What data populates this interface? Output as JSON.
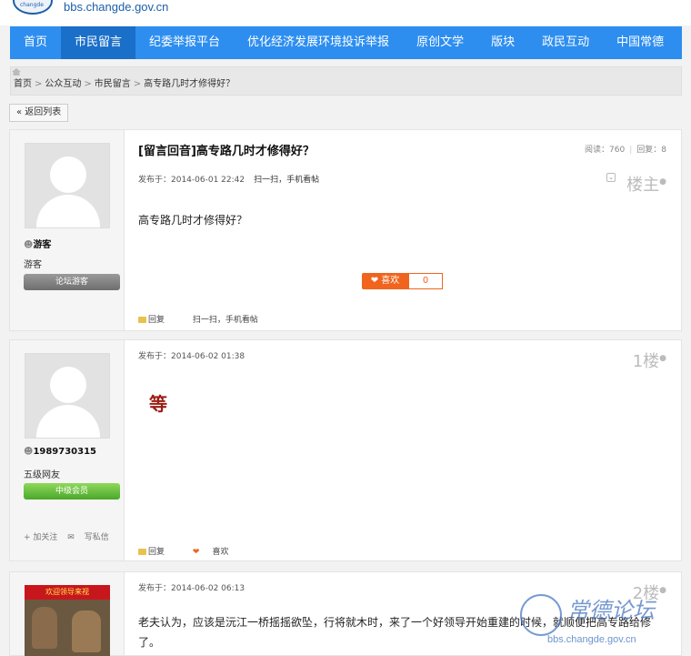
{
  "site": {
    "domain": "bbs.changde.gov.cn"
  },
  "nav": {
    "items": [
      "首页",
      "市民留言",
      "纪委举报平台",
      "优化经济发展环境投诉举报",
      "原创文学",
      "版块",
      "政民互动",
      "中国常德"
    ]
  },
  "breadcrumb": {
    "home": "首页",
    "level1": "公众互动",
    "level2": "市民留言",
    "current": "高专路几时才修得好？",
    "sep": ">"
  },
  "back_label": "« 返回列表",
  "thread": {
    "title": "[留言回音]高专路几时才修得好？",
    "views_label": "阅读：760",
    "replies_label": "回复：8"
  },
  "posts": [
    {
      "user": "游客",
      "level": "游客",
      "badge": "论坛游客",
      "time": "发布于：2014-06-01 22:42",
      "scan": "扫一扫，手机看帖",
      "floor": "楼主",
      "content": "高专路几时才修得好？",
      "like_label": "喜欢",
      "like_count": "0",
      "reply_label": "回复",
      "scan_bottom": "扫一扫，手机看帖"
    },
    {
      "user": "1989730315",
      "level": "五级网友",
      "badge": "中级会员",
      "follow_label": "+ 加关注",
      "message_label": "写私信",
      "time": "发布于：2014-06-02 01:38",
      "floor": "1楼",
      "stamp_text": "等",
      "reply_label": "回复",
      "like_label": "喜欢"
    },
    {
      "thumb_banner": "欢迎领导来视",
      "time": "发布于：2014-06-02 06:13",
      "floor": "2楼",
      "content": "老夫认为，应该是沅江一桥摇摇欲坠，行将就木时，来了一个好领导开始重建的时候，就顺便把高专路给修了。"
    }
  ],
  "watermark": {
    "title": "常德论坛",
    "url": "bbs.changde.gov.cn"
  },
  "colors": {
    "nav_bg": "#2d8ef0",
    "nav_active": "#1a6fc9",
    "like": "#f0641e"
  }
}
